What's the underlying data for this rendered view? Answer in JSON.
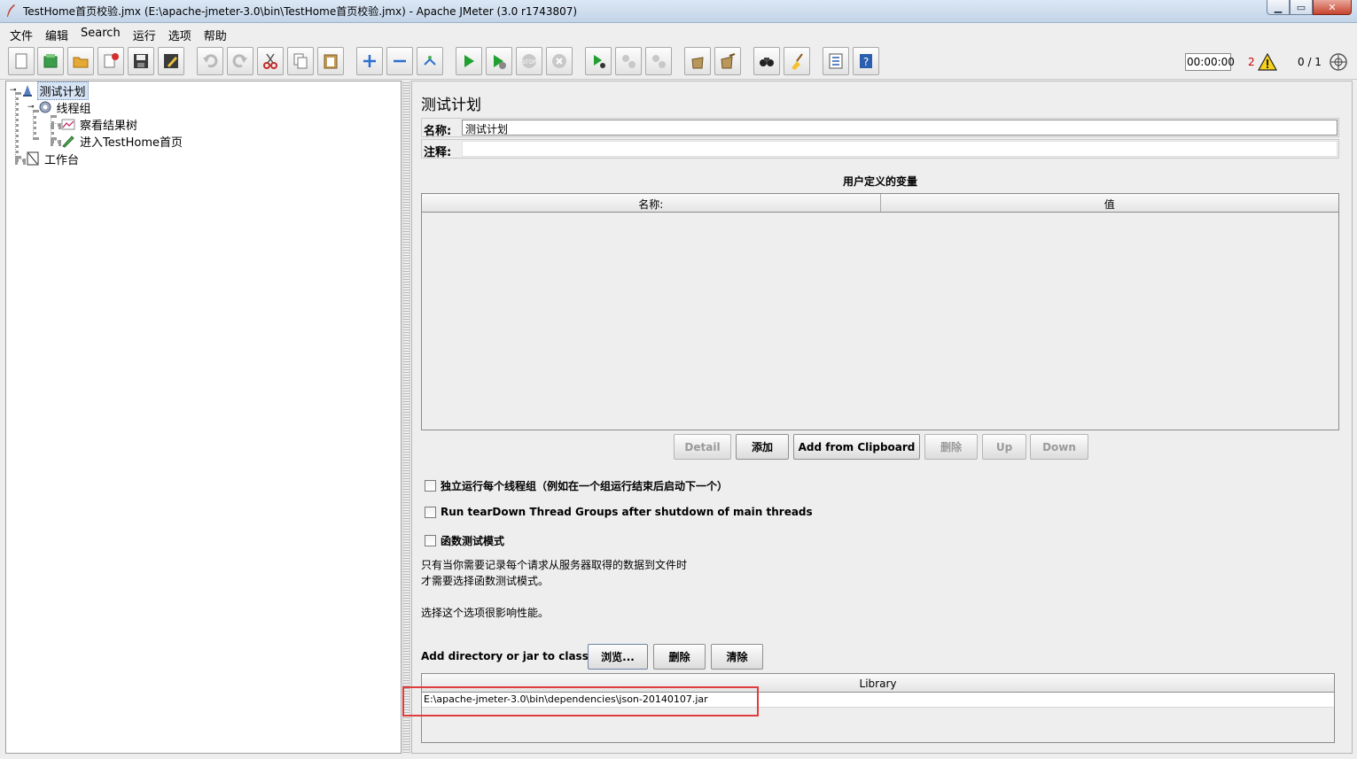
{
  "window": {
    "title": "TestHome首页校验.jmx (E:\\apache-jmeter-3.0\\bin\\TestHome首页校验.jmx) - Apache JMeter (3.0 r1743807)"
  },
  "menu": [
    "文件",
    "编辑",
    "Search",
    "运行",
    "选项",
    "帮助"
  ],
  "toolbar": {
    "buttons": [
      "new-icon",
      "templates-icon",
      "open-icon",
      "close-icon",
      "save-icon",
      "save-as-icon",
      "undo-icon",
      "redo-icon",
      "cut-icon",
      "copy-icon",
      "paste-icon",
      "expand-icon",
      "collapse-icon",
      "toggle-icon",
      "start-icon",
      "start-no-pause-icon",
      "stop-icon",
      "shutdown-icon",
      "remote-start-icon",
      "remote-stop-icon",
      "remote-shutdown-icon",
      "clear-icon",
      "clear-all-icon",
      "search-icon",
      "reset-search-icon",
      "function-helper-icon",
      "help-icon"
    ],
    "timer": "00:00:00",
    "error_count": "2",
    "thread_count": "0 / 1"
  },
  "tree": {
    "nodes": [
      {
        "label": "测试计划",
        "icon": "test-plan-icon"
      },
      {
        "label": "线程组",
        "icon": "thread-group-icon"
      },
      {
        "label": "察看结果树",
        "icon": "results-tree-icon"
      },
      {
        "label": "进入TestHome首页",
        "icon": "sampler-icon"
      },
      {
        "label": "工作台",
        "icon": "workbench-icon"
      }
    ]
  },
  "panel": {
    "title": "测试计划",
    "name_label": "名称:",
    "name_value": "测试计划",
    "comment_label": "注释:",
    "comment_value": "",
    "variables_title": "用户定义的变量",
    "columns": [
      "名称:",
      "值"
    ],
    "buttons": {
      "detail": "Detail",
      "add": "添加",
      "add_clipboard": "Add from Clipboard",
      "delete": "删除",
      "up": "Up",
      "down": "Down"
    },
    "checks": {
      "independent": "独立运行每个线程组（例如在一个组运行结束后启动下一个）",
      "teardown": "Run tearDown Thread Groups after shutdown of main threads",
      "functional": "函数测试模式"
    },
    "help": {
      "line1": "只有当你需要记录每个请求从服务器取得的数据到文件时",
      "line2": "才需要选择函数测试模式。",
      "line3": "选择这个选项很影响性能。"
    },
    "classpath": {
      "label": "Add directory or jar to classpath",
      "browse": "浏览...",
      "delete": "删除",
      "clear": "清除",
      "library_header": "Library",
      "entries": [
        "E:\\apache-jmeter-3.0\\bin\\dependencies\\json-20140107.jar"
      ]
    }
  }
}
